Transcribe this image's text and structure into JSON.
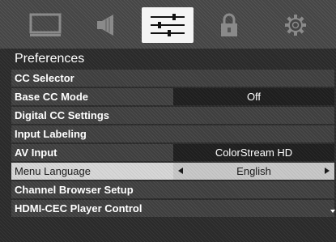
{
  "tabs": [
    {
      "icon": "tv-screen-icon",
      "selected": false
    },
    {
      "icon": "speaker-icon",
      "selected": false
    },
    {
      "icon": "sliders-icon",
      "selected": true
    },
    {
      "icon": "lock-icon",
      "selected": false
    },
    {
      "icon": "gear-icon",
      "selected": false
    }
  ],
  "title": "Preferences",
  "menu": {
    "items": [
      {
        "label": "CC Selector"
      },
      {
        "label": "Base CC Mode",
        "value": "Off"
      },
      {
        "label": "Digital CC Settings"
      },
      {
        "label": "Input Labeling"
      },
      {
        "label": "AV Input",
        "value": "ColorStream HD"
      },
      {
        "label": "Menu Language",
        "value": "English",
        "selected": true
      },
      {
        "label": "Channel Browser Setup"
      },
      {
        "label": "HDMI-CEC Player Control"
      }
    ]
  },
  "colors": {
    "background": "#2a2a2a",
    "tab_bar": "#454545",
    "selected_tab": "#f4f4f4",
    "selected_row": "#d8d8d8",
    "value_box": "#1e1e1e"
  }
}
